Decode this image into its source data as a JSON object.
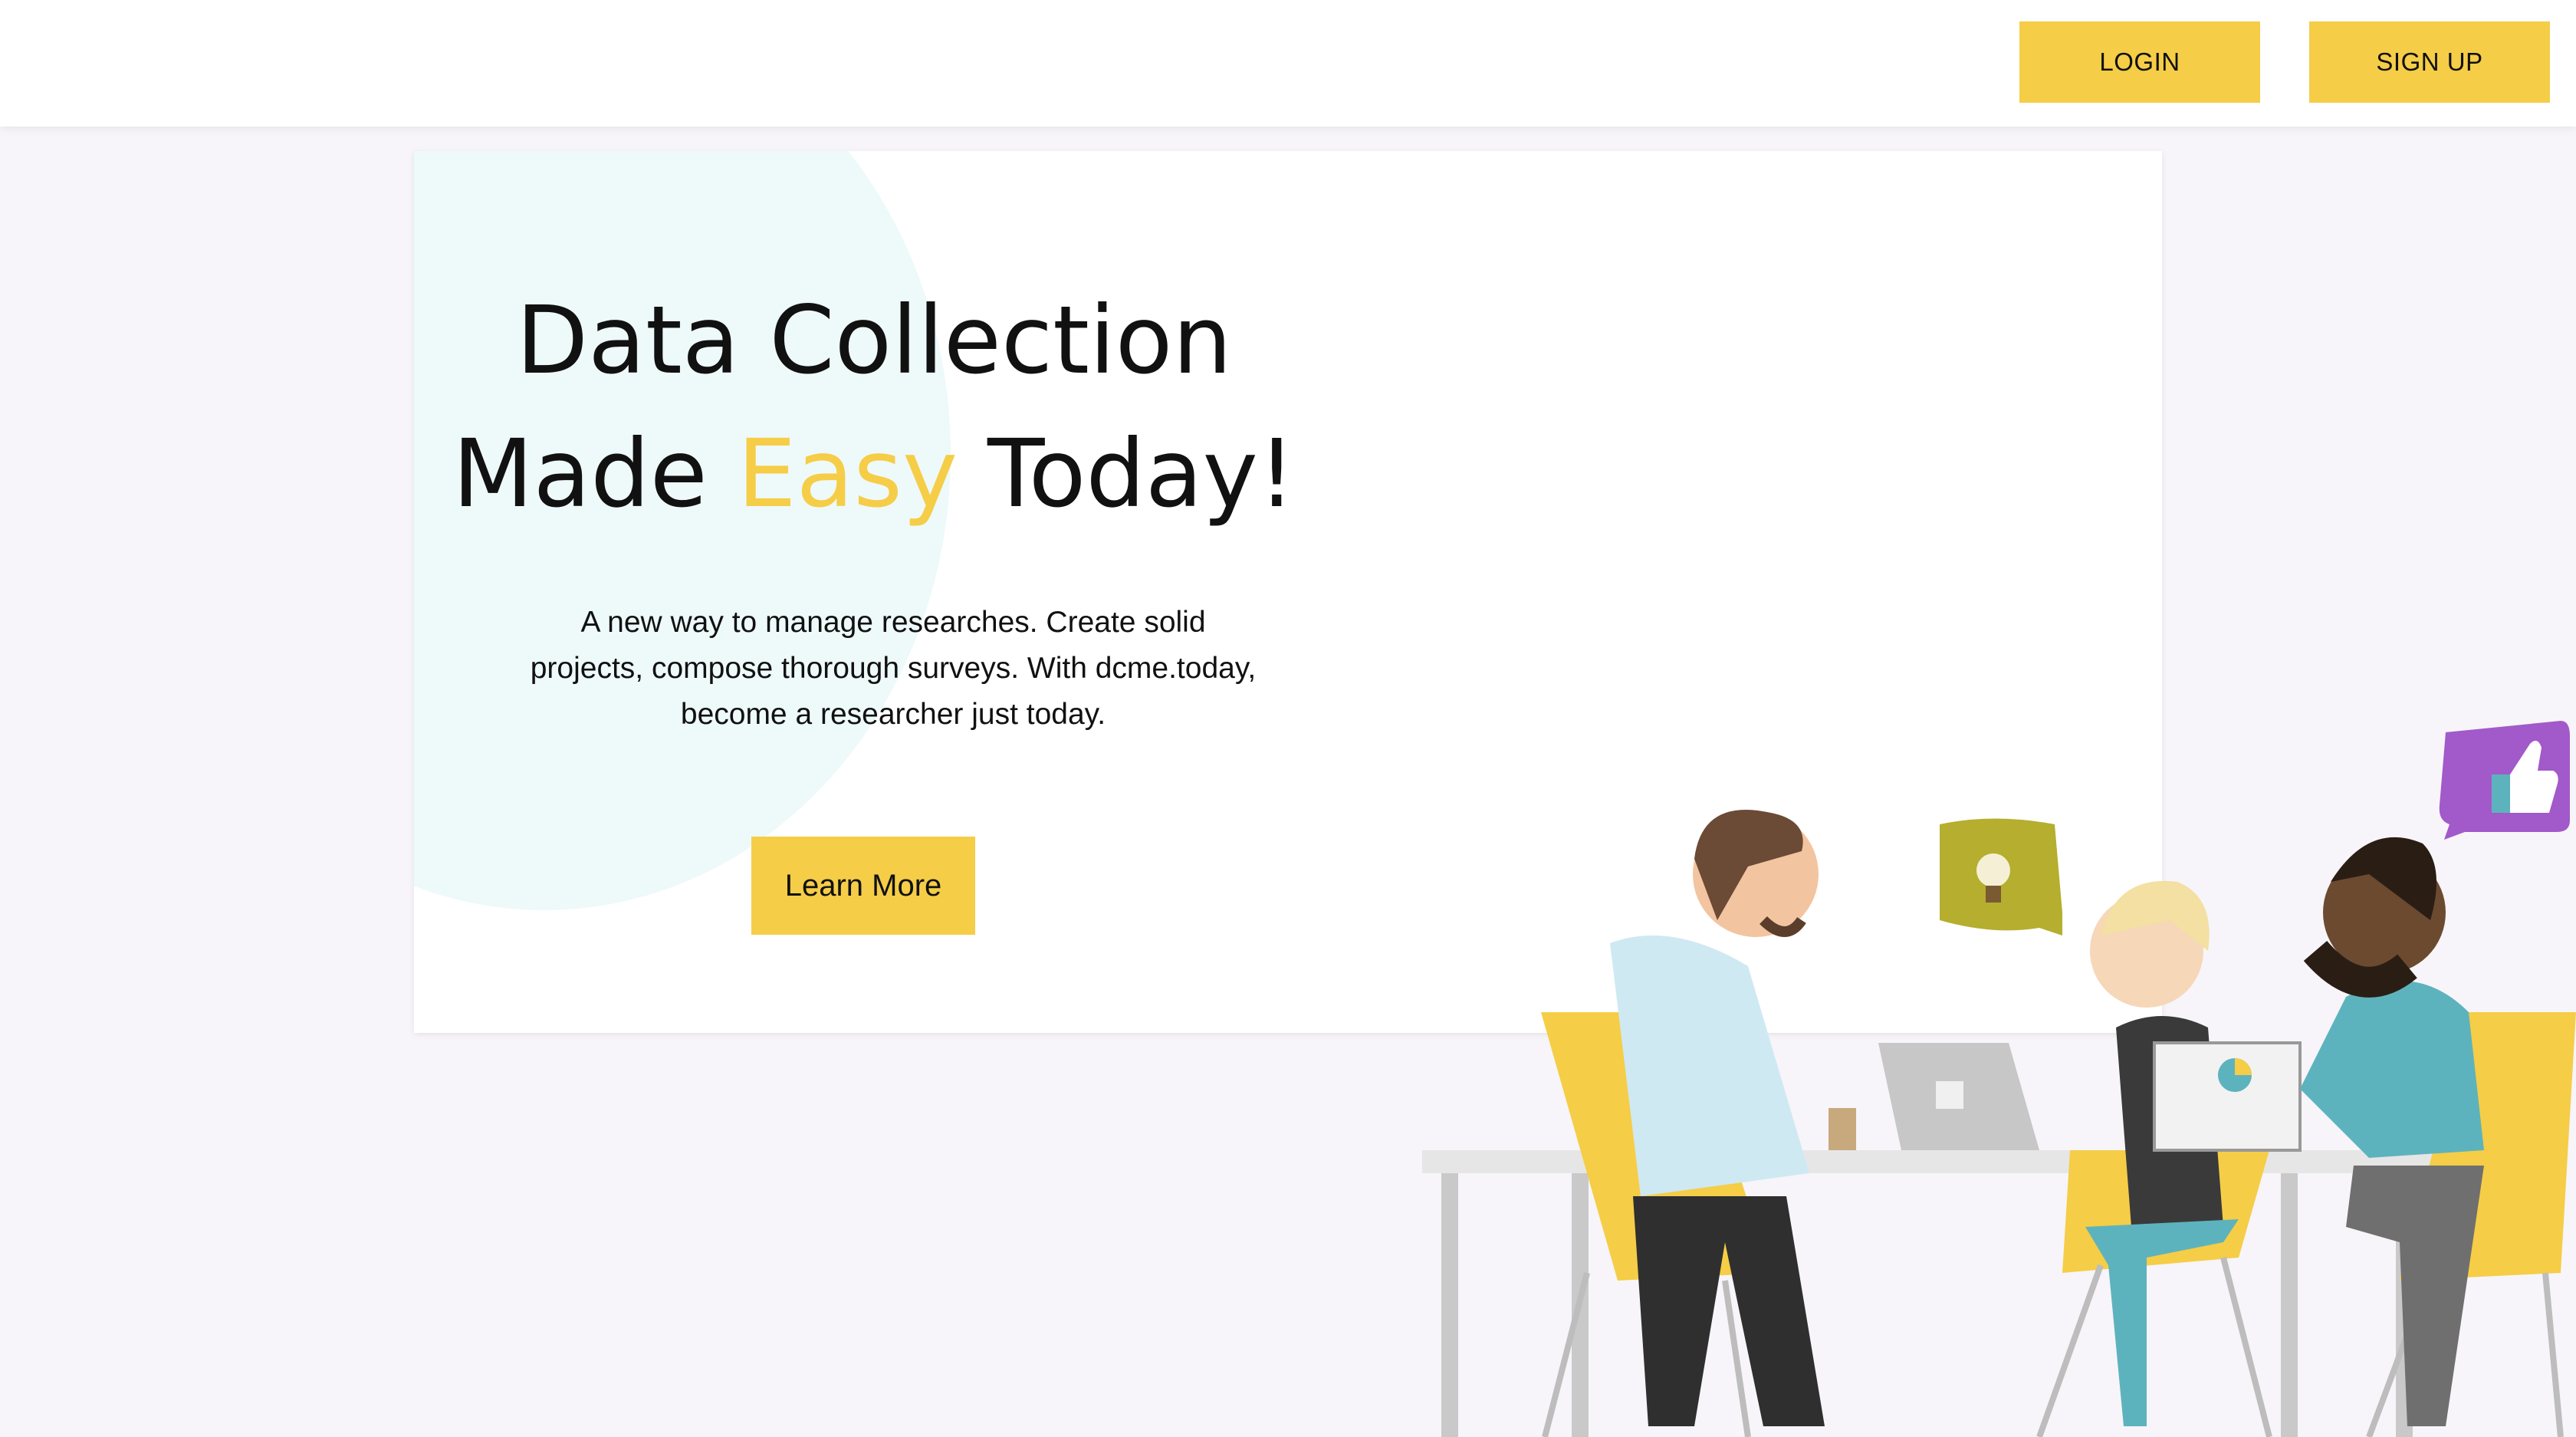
{
  "header": {
    "login_label": "LOGIN",
    "signup_label": "SIGN UP"
  },
  "hero": {
    "title_line1": "Data Collection",
    "title_made": "Made",
    "title_accent": "Easy",
    "title_end": "Today!",
    "description": "A new way to manage researches. Create solid projects, compose thorough surveys. With dcme.today, become a researcher just today.",
    "cta_label": "Learn More"
  },
  "colors": {
    "accent": "#f5cd47",
    "background": "#f7f5f9",
    "card": "#ffffff",
    "blob": "#eef9f9"
  },
  "illustration": {
    "subject": "team-meeting-illustration",
    "icons": [
      "lightbulb-icon",
      "thumbs-up-icon",
      "laptop-icon",
      "pie-chart-icon"
    ]
  }
}
